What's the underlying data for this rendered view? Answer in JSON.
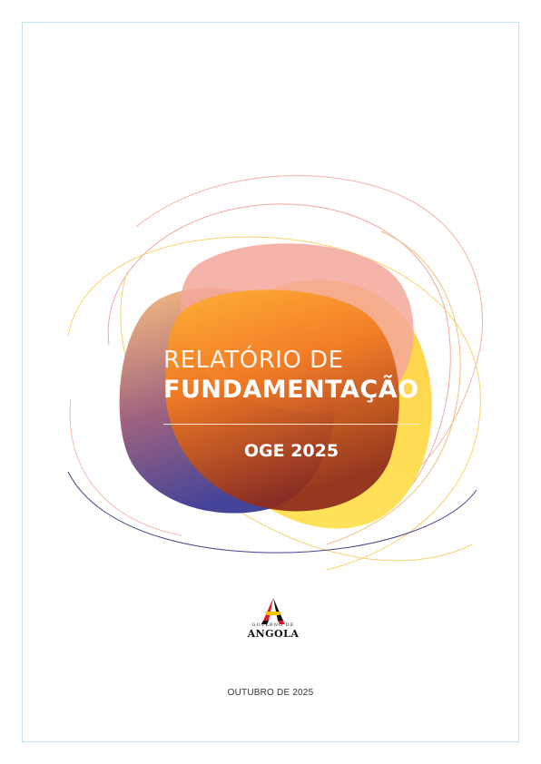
{
  "cover": {
    "title_line_1": "RELATÓRIO DE",
    "title_line_2": "FUNDAMENTAÇÃO",
    "subtitle": "OGE 2025",
    "date": "OUTUBRO DE 2025"
  },
  "logo": {
    "caption": "GOVERNO DE",
    "name": "ANGOLA",
    "icon": "governo-de-angola-emblem"
  },
  "colors": {
    "orange": "#f5891f",
    "yellow": "#ffd93a",
    "peach": "#f3a79a",
    "purple": "#4b3f8e",
    "border": "#bfe3ef"
  }
}
